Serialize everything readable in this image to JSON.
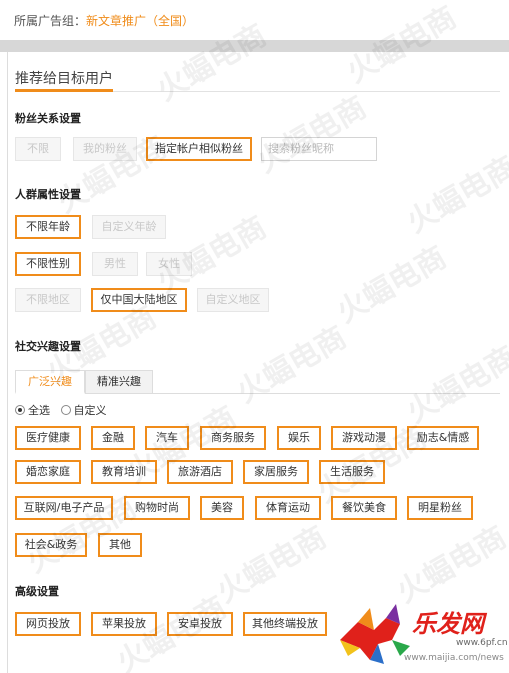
{
  "header": {
    "prefix": "所属广告组：",
    "group": "新文章推广（全国）"
  },
  "panel_title": "推荐给目标用户",
  "fans": {
    "heading": "粉丝关系设置",
    "options": [
      "不限",
      "我的粉丝",
      "指定帐户相似粉丝"
    ],
    "search_placeholder": "搜索粉丝昵称"
  },
  "crowd": {
    "heading": "人群属性设置",
    "age": [
      "不限年龄",
      "自定义年龄"
    ],
    "gender": [
      "不限性别",
      "男性",
      "女性"
    ],
    "region": [
      "不限地区",
      "仅中国大陆地区",
      "自定义地区"
    ]
  },
  "social": {
    "heading": "社交兴趣设置",
    "tabs": [
      "广泛兴趣",
      "精准兴趣"
    ],
    "radios": [
      "全选",
      "自定义"
    ],
    "interests": [
      "医疗健康",
      "金融",
      "汽车",
      "商务服务",
      "娱乐",
      "游戏动漫",
      "励志&情感",
      "婚恋家庭",
      "教育培训",
      "旅游酒店",
      "家居服务",
      "生活服务",
      "互联网/电子产品",
      "购物时尚",
      "美容",
      "体育运动",
      "餐饮美食",
      "明星粉丝",
      "社会&政务",
      "其他"
    ]
  },
  "advanced": {
    "heading": "高级设置",
    "options": [
      "网页投放",
      "苹果投放",
      "安卓投放",
      "其他终端投放"
    ]
  },
  "watermark_text": "火蝠电商",
  "logo": {
    "name": "乐发网",
    "url": "www.maijia.com",
    "url2": "www.6pf.cn",
    "news": "/news"
  },
  "colors": {
    "accent": "#f08c1a",
    "logo_red": "#e0211b"
  }
}
